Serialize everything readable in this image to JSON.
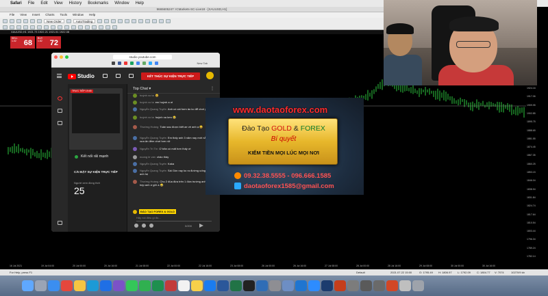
{
  "menubar": {
    "app": "Safari",
    "items": [
      "File",
      "Edit",
      "View",
      "History",
      "Bookmarks",
      "Window",
      "Help"
    ]
  },
  "mt4": {
    "window_title": "9665605247: ICMarkets-SC-Live18 - [XAUUSD,H1]",
    "menu": [
      "File",
      "View",
      "Insert",
      "Charts",
      "Tools",
      "Window",
      "Help"
    ],
    "new_order": "New Order",
    "autotrading": "AutoTrading",
    "chart_info": "XAUUSD,H1 1921.73 1922.21 1921.51 1922.08",
    "sell_label": "SELL",
    "buy_label": "BUY",
    "sell_price_small": "1.02",
    "sell_price_big": "68",
    "buy_price_small": "1.82",
    "buy_price_big": "72",
    "lot": "0.01",
    "price_ticks": [
      "1924.16",
      "1917.06",
      "1909.95",
      "1902.85",
      "1895.75",
      "1888.65",
      "1881.55",
      "1874.45",
      "1867.35",
      "1860.25",
      "1853.15",
      "1846.04",
      "1838.94",
      "1831.84",
      "1824.74",
      "1817.64",
      "1810.54",
      "1803.44",
      "1796.34",
      "1789.24",
      "1782.14"
    ],
    "time_ticks": [
      "16 Jul 2021",
      "19 Jul 04:00",
      "20 Jul 00:00",
      "20 Jul 16:00",
      "21 Jul 08:00",
      "22 Jul 00:00",
      "22 Jul 16:00",
      "23 Jul 08:00",
      "26 Jul 00:00",
      "26 Jul 16:00",
      "27 Jul 08:00",
      "28 Jul 00:00",
      "28 Jul 16:00",
      "29 Jul 08:00",
      "30 Jul 00:00",
      "30 Jul 16:00"
    ],
    "status": {
      "help": "For Help, press F1",
      "profile": "Default",
      "datetime": "2021.07.22 15:00",
      "open": "O: 1795.49",
      "high": "H: 1806.97",
      "low": "L: 1792.09",
      "close": "C: 1804.77",
      "volume": "V: 7074",
      "traffic": "10270/9 kb"
    }
  },
  "browser": {
    "url": "studio.youtube.com",
    "new_tab": "New Tab",
    "studio_label": "Studio",
    "end_stream_button": "KẾT THÚC SỰ KIỆN TRỰC TIẾP",
    "live_tag": "TRỰC TIẾP",
    "live_time": "19:48",
    "connection": "Kết nối rất mạnh",
    "settings_title": "CÀI ĐẶT SỰ KIỆN TRỰC TIẾP",
    "viewers_label": "Người xem đồng thời",
    "viewers": "25",
    "chat_title": "Top Chat",
    "messages": [
      {
        "author": "huỳnh vo ta",
        "text": "😆"
      },
      {
        "author": "huỳnh vo ta",
        "text": "em huỳnh a ơi"
      },
      {
        "author": "Nguyễn Quang Tuyên",
        "text": "Anh có cái form ảo ko để chơi ghẻ hẹ"
      },
      {
        "author": "huỳnh vo ta",
        "text": "huỳnh xa lơm 😂"
      },
      {
        "author": "Thường Hoàng",
        "text": "Tuần sau được biết ae về anh ạ 😀"
      },
      {
        "author": "Nguyễn Quang Tuyên",
        "text": "Em thấy anh 3 năm nay mới nắp, ngày xưa ăn đêm chơi hơn nữ"
      },
      {
        "author": "Nguyễn Trí Tín",
        "text": "Ơ trăn có mất hơn thấy ơi"
      },
      {
        "author": "nuong le van",
        "text": "chào thầy"
      },
      {
        "author": "Nguyễn Quang Tuyên",
        "text": "Kaka"
      },
      {
        "author": "Nguyễn Quang Tuyên",
        "text": "Sài Gòn nay ko ra đường uống bia đc anh hẹ"
      },
      {
        "author": "Thường Hoàng",
        "text": "Chu 2 đùa đừa trên 1 đứa trường anh ạ. Đang hẹp anh ơ gửi a 😂"
      }
    ],
    "pinned_name": "ĐÀO TẠO FOREX & GOLD",
    "chat_placeholder": "Hãy nói điều gì đó...",
    "char_counter": "0/200"
  },
  "banner": {
    "site": "www.daotaoforex.com",
    "line1_a": "Đào Tạo ",
    "line1_gold": "GOLD",
    "line1_and": " & ",
    "line1_forex": "FOREX",
    "line2": "Bí quyết",
    "line3": "KIẾM TIỀN MỌI LÚC MỌI NƠI",
    "phone": "09.32.38.5555 - 096.666.1585",
    "email": "daotaoforex1585@gmail.com"
  },
  "dock": {
    "apps": [
      "finder",
      "launchpad",
      "safari",
      "chrome",
      "photos",
      "skype",
      "zalo",
      "viber",
      "messages",
      "facetime",
      "sheets",
      "photo-booth",
      "calendar",
      "notes",
      "appstore",
      "word",
      "excel",
      "terminal",
      "quicktime",
      "settings",
      "preview",
      "teamviewer",
      "zoom",
      "mt4",
      "powerpoint",
      "activity",
      "trash-a",
      "trash-b",
      "ppt",
      "files",
      "trash"
    ]
  },
  "colors": {
    "end_button": "#cc1a1a",
    "oct_red": "#c9252b",
    "candle_green": "#2ecc40",
    "banner_red": "#ff2a2a",
    "gold_box": "#e7b72b"
  }
}
